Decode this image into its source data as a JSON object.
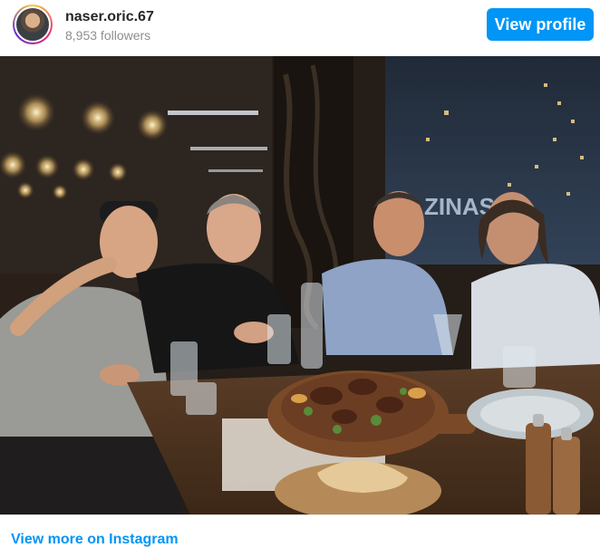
{
  "header": {
    "username": "naser.oric.67",
    "followers": "8,953 followers",
    "view_profile_label": "View profile"
  },
  "footer": {
    "view_more_label": "View more on Instagram"
  },
  "photo": {
    "sign_text": "ZINAS"
  },
  "colors": {
    "accent": "#0095f6",
    "username": "#262626",
    "muted": "#8e8e8e"
  }
}
